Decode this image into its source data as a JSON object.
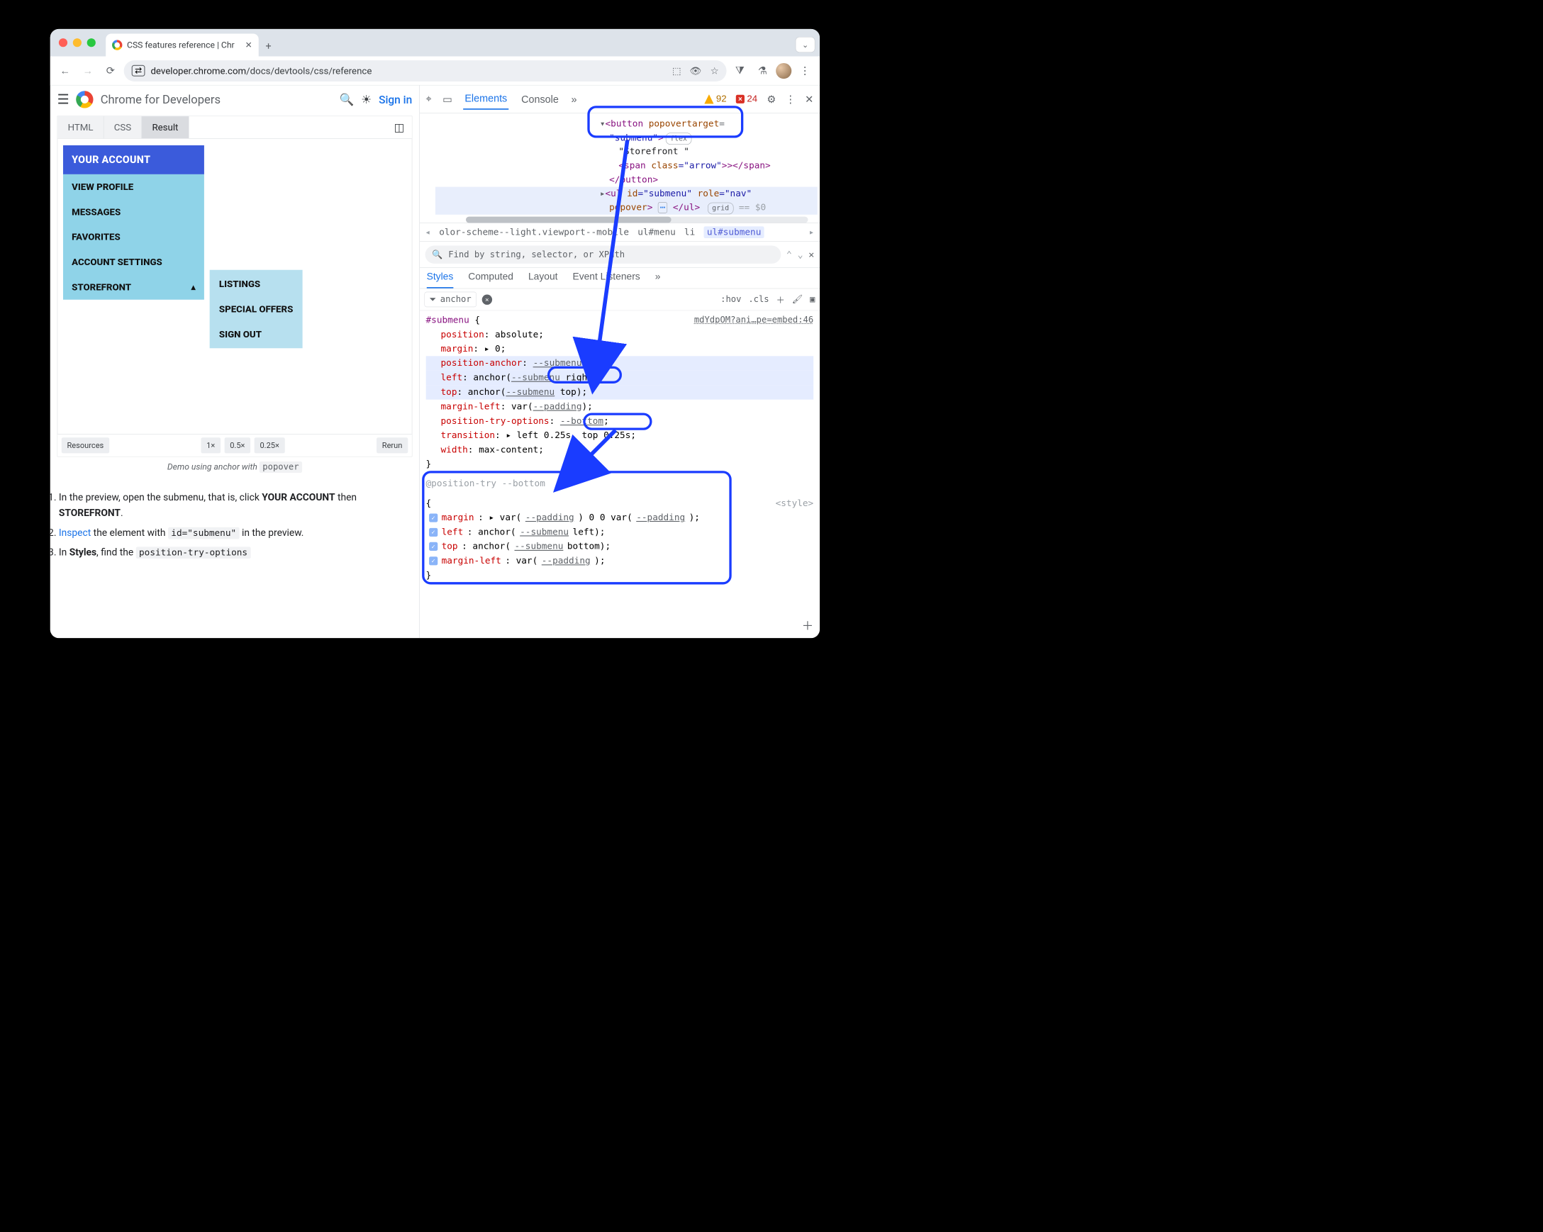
{
  "browser": {
    "tab_title": "CSS features reference | Chr",
    "url_host": "developer.chrome.com",
    "url_path": "/docs/devtools/css/reference"
  },
  "page": {
    "brand": "Chrome for Developers",
    "sign_in": "Sign in",
    "embed_tabs": {
      "html": "HTML",
      "css": "CSS",
      "result": "Result"
    },
    "menu_button": "YOUR ACCOUNT",
    "submenu_items": [
      "VIEW PROFILE",
      "MESSAGES",
      "FAVORITES",
      "ACCOUNT SETTINGS",
      "STOREFRONT"
    ],
    "storefront_glyph": "▴",
    "popover_items": [
      "LISTINGS",
      "SPECIAL OFFERS",
      "SIGN OUT"
    ],
    "footer": {
      "resources": "Resources",
      "z1": "1×",
      "z05": "0.5×",
      "z025": "0.25×",
      "rerun": "Rerun"
    },
    "caption_prefix": "Demo using anchor with ",
    "caption_code": "popover",
    "steps": {
      "s1a": "In the preview, open the submenu, that is, click ",
      "s1b": "YOUR ACCOUNT",
      "s1c": " then ",
      "s1d": "STOREFRONT",
      "s1e": ".",
      "s2a": "Inspect",
      "s2b": " the element with ",
      "s2c": "id=\"submenu\"",
      "s2d": " in the preview.",
      "s3a": "In ",
      "s3b": "Styles",
      "s3c": ", find the ",
      "s3d": "position-try-options"
    }
  },
  "devtools": {
    "tabs": {
      "elements": "Elements",
      "console": "Console"
    },
    "warn_count": "92",
    "err_count": "24",
    "dom": {
      "l1a": "<button",
      "l1b": " popovertarget",
      "l1c": "=",
      "l2a": "\"submenu\"",
      "l2b": ">",
      "flex_badge": "flex",
      "l3": "\"Storefront \"",
      "l4a": "<span",
      "l4b": " class",
      "l4c": "=\"arrow\"",
      "l4d": ">></span>",
      "l5": "</button>",
      "l6a": "<ul",
      "l6b": " id",
      "l6c": "=\"submenu\"",
      "l6d": " role",
      "l6e": "=\"nav\"",
      "l7a": "popover",
      "l7b": ">",
      "l7dots": "⋯",
      "l7c": "</ul>",
      "grid_badge": "grid",
      "l7d": " == $0"
    },
    "crumbs": {
      "c1": "olor-scheme--light.viewport--mobile",
      "c2": "ul#menu",
      "c3": "li",
      "c4": "ul#submenu"
    },
    "find_placeholder": "Find by string, selector, or XPath",
    "subtabs": {
      "styles": "Styles",
      "computed": "Computed",
      "layout": "Layout",
      "listeners": "Event Listeners"
    },
    "filter_text": "anchor",
    "toggles": {
      "hov": ":hov",
      "cls": ".cls"
    },
    "rule_source": "mdYdpOM?ani…pe=embed:46",
    "rule": {
      "selector": "#submenu",
      "open": " {",
      "r1p": "position",
      "r1v": ": absolute;",
      "r2p": "margin",
      "r2v": ": ▸ 0;",
      "r3p": "position-anchor",
      "r3c": ": ",
      "r3v": "--submenu",
      "r3e": ";",
      "r4p": "left",
      "r4c": ": anchor(",
      "r4v": "--submenu",
      "r4c2": " right);",
      "r5p": "top",
      "r5c": ": anchor(",
      "r5v": "--submenu",
      "r5c2": " top);",
      "r6p": "margin-left",
      "r6c": ": var(",
      "r6v": "--padding",
      "r6c2": ");",
      "r7p": "position-try-options",
      "r7c": ": ",
      "r7v": "--bottom",
      "r7e": ";",
      "r8p": "transition",
      "r8v": ": ▸ left 0.25s, top 0.25s;",
      "r9p": "width",
      "r9v": ": max-content;",
      "close": "}"
    },
    "atrule": {
      "head": "@position-try --bottom",
      "open": "{",
      "styletag": "<style>",
      "a1p": "margin",
      "a1c": ": ▸ var(",
      "a1v": "--padding",
      "a1c2": ") 0 0 var(",
      "a1v2": "--padding",
      "a1c3": ");",
      "a2p": "left",
      "a2c": ": anchor(",
      "a2v": "--submenu",
      "a2c2": " left);",
      "a3p": "top",
      "a3c": ": anchor(",
      "a3v": "--submenu",
      "a3c2": " bottom);",
      "a4p": "margin-left",
      "a4c": ": var(",
      "a4v": "--padding",
      "a4c2": ");",
      "close": "}"
    }
  }
}
